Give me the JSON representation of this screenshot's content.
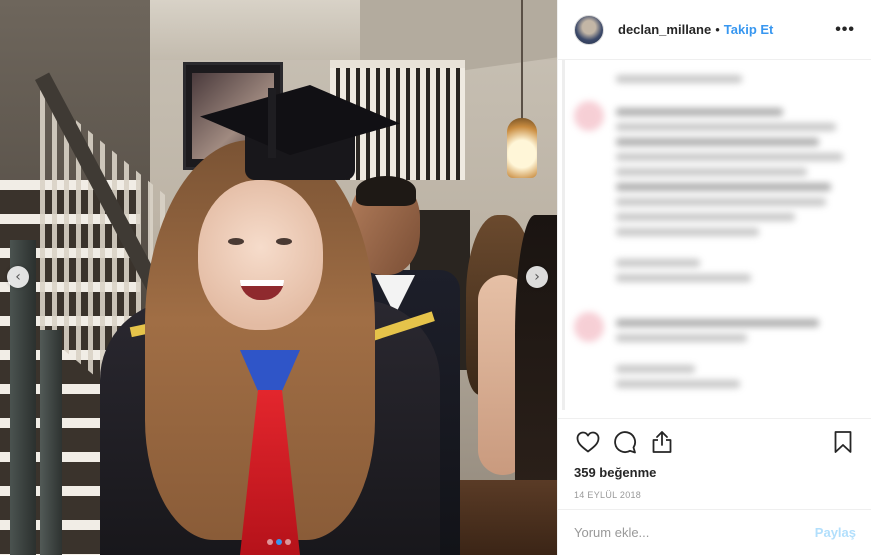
{
  "post": {
    "photo": {
      "alt": "",
      "carousel": {
        "total": 3,
        "active": 1
      },
      "prev_arrow": "‹",
      "next_arrow": "›"
    },
    "header": {
      "username": "declan_millane",
      "separator": "•",
      "follow_label": "Takip Et",
      "more_label": "•••"
    },
    "actions": {
      "like_icon": "heart-icon",
      "comment_icon": "comment-bubble-icon",
      "share_icon": "share-icon",
      "save_icon": "bookmark-icon"
    },
    "likes_text": "359 beğenme",
    "date_text": "14 EYLÜL 2018",
    "comment_box": {
      "placeholder": "Yorum ekle...",
      "submit_label": "Paylaş"
    },
    "colors": {
      "accent": "#3897f0",
      "text": "#262626",
      "muted": "#999999",
      "disabled_submit": "#b2dffc"
    }
  }
}
